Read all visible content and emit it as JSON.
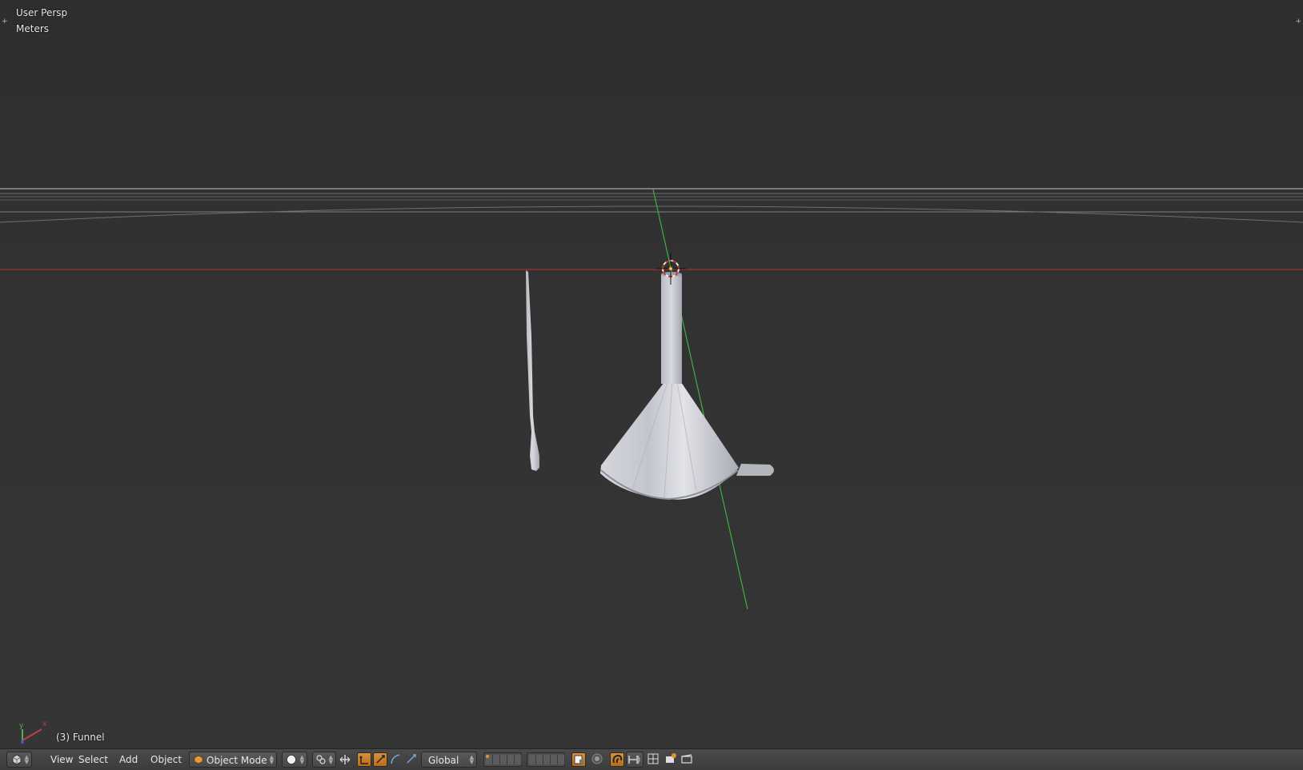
{
  "viewport": {
    "view_name": "User Persp",
    "units": "Meters",
    "active_object": "(3) Funnel",
    "axis_x_label": "x",
    "axis_y_label": "y",
    "corner_left_glyph": "+",
    "corner_right_glyph": "+"
  },
  "header": {
    "editor_icon": "3d-view-icon",
    "menus": [
      "View",
      "Select",
      "Add",
      "Object"
    ],
    "mode": "Object Mode",
    "mode_icon": "cube-icon",
    "shading_icon": "solid-sphere-icon",
    "pivot_icon": "pivot-icon",
    "transform_orientation": "Global",
    "manipulator_icons": [
      "translate-icon",
      "rotate-icon",
      "scale-icon"
    ],
    "layer_icons": [
      "proportional-edit-icon",
      "snap-magnet-icon",
      "snap-target-icon",
      "render-icon",
      "camera-icon"
    ]
  },
  "colors": {
    "accent_orange": "#d9913a",
    "x_axis": "#b03a3a",
    "y_axis": "#3fb43f"
  }
}
